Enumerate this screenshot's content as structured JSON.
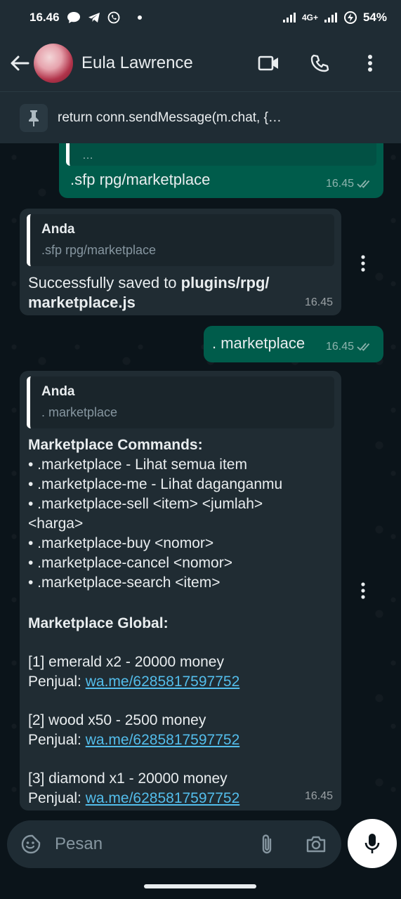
{
  "status_bar": {
    "time": "16.46",
    "network": "4G+",
    "battery": "54%"
  },
  "header": {
    "contact_name": "Eula Lawrence"
  },
  "pinned": {
    "text": "return conn.sendMessage(m.chat, {…"
  },
  "messages": [
    {
      "direction": "out",
      "quote_text": "…",
      "text": ".sfp rpg/marketplace",
      "time": "16.45",
      "read": true
    },
    {
      "direction": "in",
      "quote_name": "Anda",
      "quote_text": ".sfp rpg/marketplace",
      "text_prefix": "Successfully saved to ",
      "text_bold_1": "plugins/rpg/",
      "text_bold_2": "marketplace.js",
      "time": "16.45"
    },
    {
      "direction": "out",
      "text": ". marketplace",
      "time": "16.45",
      "read": true
    },
    {
      "direction": "in",
      "quote_name": "Anda",
      "quote_text": ". marketplace",
      "commands_title": "Marketplace Commands:",
      "commands": [
        "• .marketplace - Lihat semua item",
        "• .marketplace-me - Lihat daganganmu",
        "• .marketplace-sell <item> <jumlah>",
        "<harga>",
        "• .marketplace-buy <nomor>",
        "• .marketplace-cancel <nomor>",
        "• .marketplace-search <item>"
      ],
      "global_title": "Marketplace Global:",
      "listings": [
        {
          "line": "[1] emerald x2 - 20000 money",
          "seller_label": "Penjual: ",
          "seller_link": "wa.me/6285817597752"
        },
        {
          "line": "[2] wood x50 - 2500 money",
          "seller_label": "Penjual: ",
          "seller_link": "wa.me/6285817597752"
        },
        {
          "line": "[3] diamond x1 - 20000 money",
          "seller_label": "Penjual: ",
          "seller_link": "wa.me/6285817597752"
        }
      ],
      "time": "16.45"
    }
  ],
  "input": {
    "placeholder": "Pesan"
  },
  "colors": {
    "background": "#0b141a",
    "bar": "#1f2c34",
    "outgoing_bubble": "#005c4b",
    "incoming_bubble": "#202c33",
    "link": "#53bdeb"
  }
}
